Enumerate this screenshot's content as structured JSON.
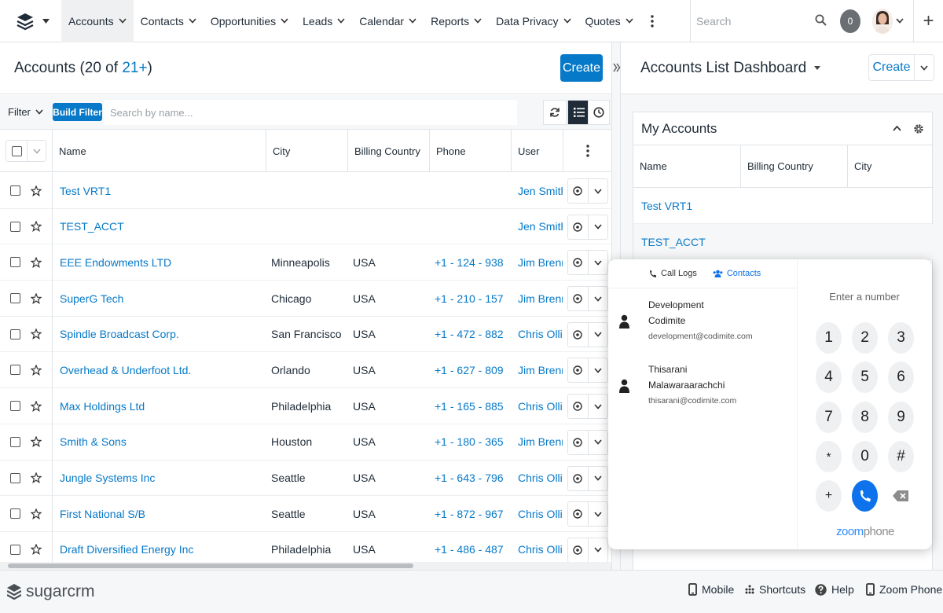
{
  "nav": {
    "tabs": [
      {
        "label": "Accounts",
        "active": true
      },
      {
        "label": "Contacts"
      },
      {
        "label": "Opportunities"
      },
      {
        "label": "Leads"
      },
      {
        "label": "Calendar"
      },
      {
        "label": "Reports"
      },
      {
        "label": "Data Privacy"
      },
      {
        "label": "Quotes"
      }
    ],
    "search_placeholder": "Search",
    "notification_count": "0"
  },
  "list": {
    "title": "Accounts",
    "count_prefix": "(20 of ",
    "count_total": "21+",
    "count_suffix": ")",
    "create_label": "Create",
    "filter_label": "Filter",
    "build_filter_label": "Build Filter",
    "search_placeholder": "Search by name...",
    "columns": [
      "Name",
      "City",
      "Billing Country",
      "Phone",
      "User"
    ],
    "rows": [
      {
        "name": "Test VRT1",
        "city": "",
        "country": "",
        "phone": "",
        "user": "Jen Smith"
      },
      {
        "name": "TEST_ACCT",
        "city": "",
        "country": "",
        "phone": "",
        "user": "Jen Smith"
      },
      {
        "name": "EEE Endowments LTD",
        "city": "Minneapolis",
        "country": "USA",
        "phone": "+1 - 124 - 938 - ...",
        "user": "Jim Brennan"
      },
      {
        "name": "SuperG Tech",
        "city": "Chicago",
        "country": "USA",
        "phone": "+1 - 210 - 157 - ...",
        "user": "Jim Brennan"
      },
      {
        "name": "Spindle Broadcast Corp.",
        "city": "San Francisco",
        "country": "USA",
        "phone": "+1 - 472 - 882 - ...",
        "user": "Chris Olliver"
      },
      {
        "name": "Overhead & Underfoot Ltd.",
        "city": "Orlando",
        "country": "USA",
        "phone": "+1 - 627 - 809 - ...",
        "user": "Jim Brennan"
      },
      {
        "name": "Max Holdings Ltd",
        "city": "Philadelphia",
        "country": "USA",
        "phone": "+1 - 165 - 885 - ...",
        "user": "Chris Olliver"
      },
      {
        "name": "Smith & Sons",
        "city": "Houston",
        "country": "USA",
        "phone": "+1 - 180 - 365 - ...",
        "user": "Jim Brennan"
      },
      {
        "name": "Jungle Systems Inc",
        "city": "Seattle",
        "country": "USA",
        "phone": "+1 - 643 - 796 - ...",
        "user": "Chris Olliver"
      },
      {
        "name": "First National S/B",
        "city": "Seattle",
        "country": "USA",
        "phone": "+1 - 872 - 967 - ...",
        "user": "Chris Olliver"
      },
      {
        "name": "Draft Diversified Energy Inc",
        "city": "Philadelphia",
        "country": "USA",
        "phone": "+1 - 486 - 487 - ...",
        "user": "Chris Olliver"
      }
    ]
  },
  "dashboard": {
    "title": "Accounts List Dashboard",
    "create_label": "Create",
    "dashlet_title": "My Accounts",
    "columns": [
      "Name",
      "Billing Country",
      "City"
    ],
    "rows": [
      "Test VRT1",
      "TEST_ACCT"
    ]
  },
  "zoom": {
    "tab_call_logs": "Call Logs",
    "tab_contacts": "Contacts",
    "contacts": [
      {
        "first": "Development",
        "last": "Codimite",
        "email": "development@codimite.com"
      },
      {
        "first": "Thisarani",
        "last": "Malawaraarachchi",
        "email": "thisarani@codimite.com"
      }
    ],
    "enter_placeholder": "Enter a number",
    "keys": [
      "1",
      "2",
      "3",
      "4",
      "5",
      "6",
      "7",
      "8",
      "9",
      "*",
      "0",
      "#",
      "+"
    ],
    "logo_zoom": "zoom",
    "logo_phone": "phone"
  },
  "footer": {
    "brand": "sugarcrm",
    "mobile": "Mobile",
    "shortcuts": "Shortcuts",
    "help": "Help",
    "zoom_phone": "Zoom Phone"
  }
}
